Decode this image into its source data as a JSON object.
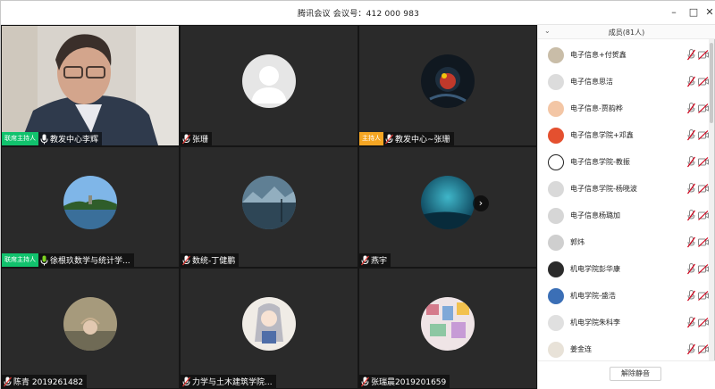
{
  "window": {
    "title": "腾讯会议  会议号：412 000 983",
    "minimize_symbol": "–",
    "maximize_symbol": "□",
    "close_symbol": "✕"
  },
  "grid": {
    "next_symbol": "›",
    "tiles": [
      {
        "name": "教发中心李辉",
        "badge": "联席主持人",
        "badge_color": "#11c26d",
        "type": "video"
      },
      {
        "name": "张珊",
        "badge": "",
        "type": "default-avatar"
      },
      {
        "name": "教发中心~张珊",
        "badge": "主持人",
        "badge_color": "#f5a623",
        "type": "avatar"
      },
      {
        "name": "徐根玖数学与统计学...",
        "badge": "联席主持人",
        "badge_color": "#11c26d",
        "type": "avatar"
      },
      {
        "name": "数统-丁健鹏",
        "badge": "",
        "type": "avatar"
      },
      {
        "name": "燕宇",
        "badge": "",
        "type": "avatar"
      },
      {
        "name": "陈青 2019261482",
        "badge": "",
        "type": "avatar"
      },
      {
        "name": "力学与土木建筑学院...",
        "badge": "",
        "type": "avatar"
      },
      {
        "name": "张瑞晨2019201659",
        "badge": "",
        "type": "avatar"
      }
    ]
  },
  "panel": {
    "collapse_symbol": "⌄",
    "title": "成员(81人)",
    "members": [
      {
        "name": "电子信息+付贺鑫"
      },
      {
        "name": "电子信息思洁"
      },
      {
        "name": "电子信息-贾韵桦"
      },
      {
        "name": "电子信息学院+邓鑫"
      },
      {
        "name": "电子信息学院-教振"
      },
      {
        "name": "电子信息学院-杨晓波"
      },
      {
        "name": "电子信息杨璐加"
      },
      {
        "name": "郭炜"
      },
      {
        "name": "机电学院彭华康"
      },
      {
        "name": "机电学院-盛浩"
      },
      {
        "name": "机电学院朱科李"
      },
      {
        "name": "姜金连"
      }
    ],
    "unmute_all_label": "解除静音"
  },
  "colors": {
    "host_badge": "#f5a623",
    "cohost_badge": "#11c26d",
    "muted_icon": "#d0021b",
    "tile_bg": "#2a2a2a"
  }
}
